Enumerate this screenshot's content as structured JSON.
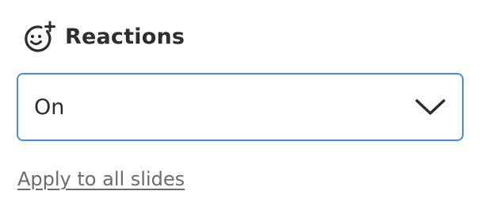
{
  "section": {
    "title": "Reactions",
    "icon": "add-reaction-icon"
  },
  "reactions_select": {
    "value": "On",
    "icon": "chevron-down-icon",
    "border_color": "#4a8ae3"
  },
  "apply_link": {
    "label": "Apply to all slides"
  }
}
